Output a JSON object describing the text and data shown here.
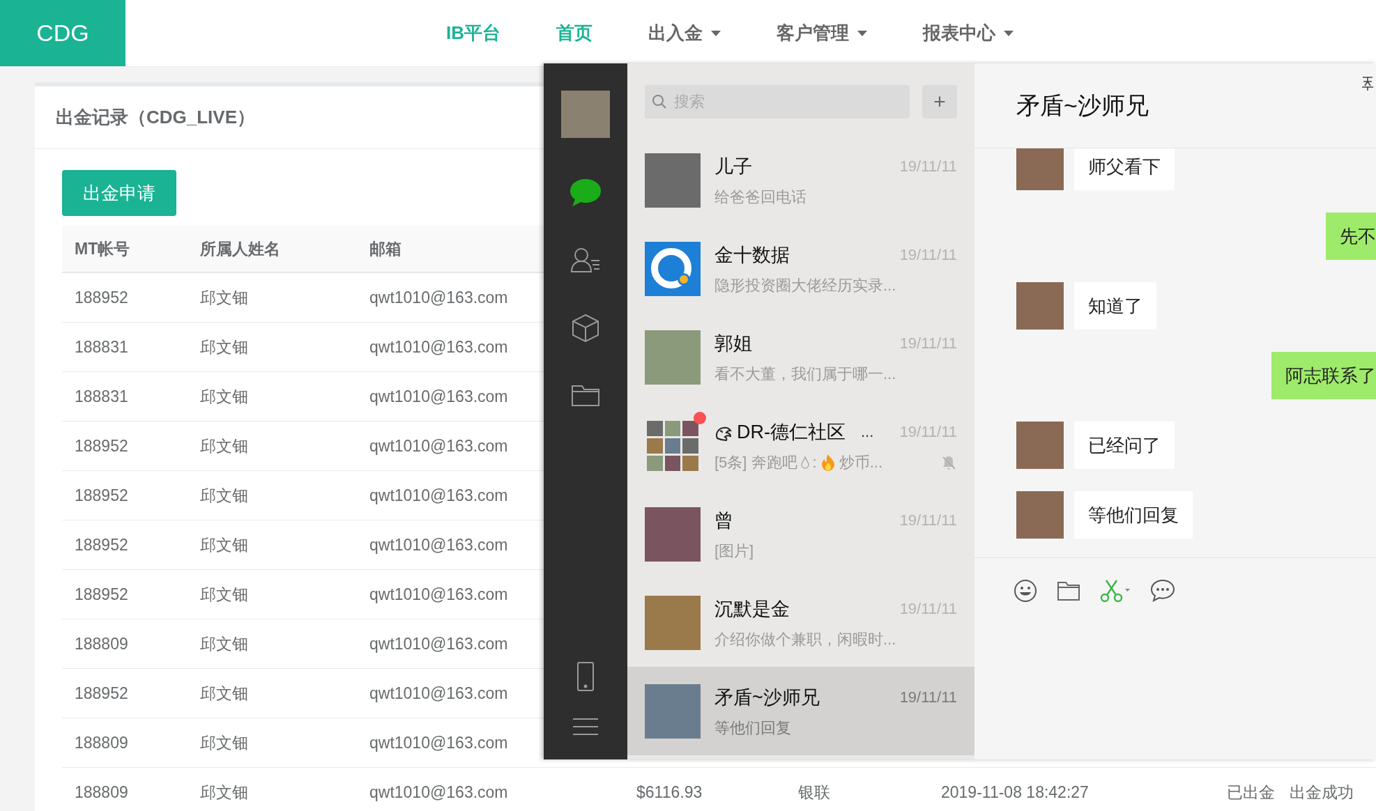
{
  "header": {
    "logo": "CDG",
    "brand": "IB平台",
    "nav": [
      {
        "label": "首页",
        "selected": true,
        "dropdown": false
      },
      {
        "label": "出入金",
        "selected": false,
        "dropdown": true
      },
      {
        "label": "客户管理",
        "selected": false,
        "dropdown": true
      },
      {
        "label": "报表中心",
        "selected": false,
        "dropdown": true
      }
    ]
  },
  "panel": {
    "title": "出金记录（CDG_LIVE）",
    "action_button": "出金申请",
    "table": {
      "columns": [
        "MT帐号",
        "所属人姓名",
        "邮箱"
      ],
      "rows": [
        {
          "cells": [
            "188952",
            "邱文钿",
            "qwt1010@163.com"
          ]
        },
        {
          "cells": [
            "188831",
            "邱文钿",
            "qwt1010@163.com"
          ]
        },
        {
          "cells": [
            "188831",
            "邱文钿",
            "qwt1010@163.com"
          ]
        },
        {
          "cells": [
            "188952",
            "邱文钿",
            "qwt1010@163.com"
          ]
        },
        {
          "cells": [
            "188952",
            "邱文钿",
            "qwt1010@163.com"
          ]
        },
        {
          "cells": [
            "188952",
            "邱文钿",
            "qwt1010@163.com"
          ]
        },
        {
          "cells": [
            "188952",
            "邱文钿",
            "qwt1010@163.com"
          ]
        },
        {
          "cells": [
            "188809",
            "邱文钿",
            "qwt1010@163.com"
          ]
        },
        {
          "cells": [
            "188952",
            "邱文钿",
            "qwt1010@163.com"
          ]
        },
        {
          "cells": [
            "188809",
            "邱文钿",
            "qwt1010@163.com"
          ]
        },
        {
          "cells": [
            "188809",
            "邱文钿",
            "qwt1010@163.com",
            "$6116.93",
            "银联",
            "2019-11-08 18:42:27",
            "已出金",
            "出金成功"
          ]
        }
      ]
    }
  },
  "wechat": {
    "sidebar": {
      "items": [
        {
          "kind": "chat",
          "selected": true
        },
        {
          "kind": "contacts",
          "selected": false
        },
        {
          "kind": "cube",
          "selected": false
        },
        {
          "kind": "folder",
          "selected": false
        },
        {
          "kind": "phone",
          "selected": false
        },
        {
          "kind": "menu",
          "selected": false
        }
      ]
    },
    "search": {
      "placeholder": "搜索"
    },
    "add_button": "+",
    "conversations": [
      {
        "kind": "photo",
        "name": "儿子",
        "time": "19/11/11",
        "preview": "给爸爸回电话",
        "selected": false,
        "unread": false,
        "muted": false
      },
      {
        "kind": "logo",
        "name": "金十数据",
        "time": "19/11/11",
        "preview": "隐形投资圈大佬经历实录...",
        "selected": false,
        "unread": false,
        "muted": false
      },
      {
        "kind": "photo",
        "name": "郭姐",
        "time": "19/11/11",
        "preview": "看不大董，我们属于哪一...",
        "selected": false,
        "unread": false,
        "muted": false
      },
      {
        "kind": "group",
        "name": "DR-德仁社区",
        "name_suffix": "...",
        "time": "19/11/11",
        "preview_parts": [
          {
            "kind": "text",
            "text": "[5条] 奔跑吧"
          },
          {
            "kind": "drop"
          },
          {
            "kind": "text",
            "text": ":"
          },
          {
            "kind": "fire"
          },
          {
            "kind": "text",
            "text": "炒币..."
          }
        ],
        "selected": false,
        "unread": true,
        "muted": true
      },
      {
        "kind": "photo",
        "name": "曾",
        "time": "19/11/11",
        "preview": "[图片]",
        "selected": false,
        "unread": false,
        "muted": false
      },
      {
        "kind": "photo",
        "name": "沉默是金",
        "time": "19/11/11",
        "preview": "介绍你做个兼职，闲暇时...",
        "selected": false,
        "unread": false,
        "muted": false
      },
      {
        "kind": "photo",
        "name": "矛盾~沙师兄",
        "time": "19/11/11",
        "preview": "等他们回复",
        "selected": true,
        "unread": false,
        "muted": false
      }
    ],
    "chat": {
      "title": "矛盾~沙师兄",
      "messages": [
        {
          "kind": "received",
          "text": "师父看下"
        },
        {
          "kind": "sent",
          "text": "先不"
        },
        {
          "kind": "received",
          "text": "知道了"
        },
        {
          "kind": "sent",
          "text": "阿志联系了"
        },
        {
          "kind": "received",
          "text": "已经问了"
        },
        {
          "kind": "received",
          "text": "等他们回复"
        }
      ]
    }
  }
}
